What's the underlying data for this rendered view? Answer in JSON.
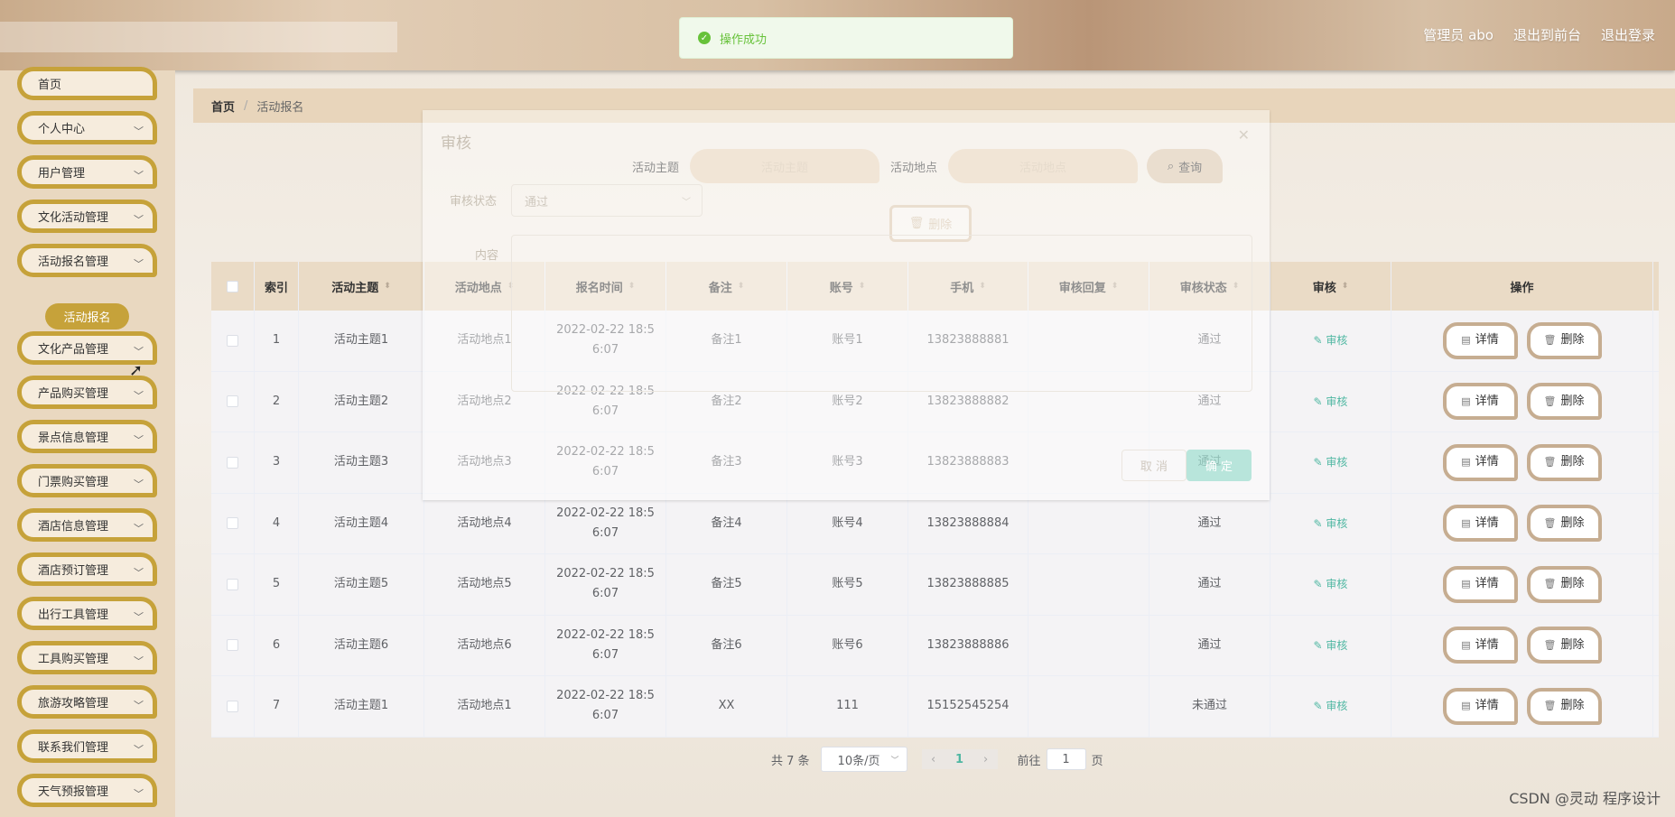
{
  "header": {
    "user_label": "管理员 abo",
    "back_label": "退出到前台",
    "logout_label": "退出登录"
  },
  "toast": {
    "message": "操作成功"
  },
  "sidebar": {
    "items": [
      {
        "label": "首页"
      },
      {
        "label": "个人中心"
      },
      {
        "label": "用户管理"
      },
      {
        "label": "文化活动管理"
      },
      {
        "label": "活动报名管理"
      },
      {
        "label": "文化产品管理"
      },
      {
        "label": "产品购买管理"
      },
      {
        "label": "景点信息管理"
      },
      {
        "label": "门票购买管理"
      },
      {
        "label": "酒店信息管理"
      },
      {
        "label": "酒店预订管理"
      },
      {
        "label": "出行工具管理"
      },
      {
        "label": "工具购买管理"
      },
      {
        "label": "旅游攻略管理"
      },
      {
        "label": "联系我们管理"
      },
      {
        "label": "天气预报管理"
      }
    ],
    "active_sub": "活动报名"
  },
  "breadcrumb": {
    "home": "首页",
    "separator": "/",
    "current": "活动报名"
  },
  "search": {
    "topic_label": "活动主题",
    "topic_placeholder": "活动主题",
    "place_label": "活动地点",
    "place_placeholder": "活动地点",
    "query_label": "查询"
  },
  "delete_label": "删除",
  "dialog": {
    "title": "审核",
    "status_label": "审核状态",
    "status_value": "通过",
    "content_label": "内容",
    "cancel_label": "取 消",
    "confirm_label": "确 定"
  },
  "table": {
    "headers": [
      "索引",
      "活动主题",
      "活动地点",
      "报名时间",
      "备注",
      "账号",
      "手机",
      "审核回复",
      "审核状态",
      "审核",
      "操作"
    ],
    "audit_link": "审核",
    "detail_label": "详情",
    "delete_label": "删除",
    "rows": [
      {
        "idx": "1",
        "topic": "活动主题1",
        "place": "活动地点1",
        "time1": "2022-02-22 18:5",
        "time2": "6:07",
        "note": "备注1",
        "account": "账号1",
        "phone": "13823888881",
        "reply": "",
        "status": "通过"
      },
      {
        "idx": "2",
        "topic": "活动主题2",
        "place": "活动地点2",
        "time1": "2022-02-22 18:5",
        "time2": "6:07",
        "note": "备注2",
        "account": "账号2",
        "phone": "13823888882",
        "reply": "",
        "status": "通过"
      },
      {
        "idx": "3",
        "topic": "活动主题3",
        "place": "活动地点3",
        "time1": "2022-02-22 18:5",
        "time2": "6:07",
        "note": "备注3",
        "account": "账号3",
        "phone": "13823888883",
        "reply": "",
        "status": "通过"
      },
      {
        "idx": "4",
        "topic": "活动主题4",
        "place": "活动地点4",
        "time1": "2022-02-22 18:5",
        "time2": "6:07",
        "note": "备注4",
        "account": "账号4",
        "phone": "13823888884",
        "reply": "",
        "status": "通过"
      },
      {
        "idx": "5",
        "topic": "活动主题5",
        "place": "活动地点5",
        "time1": "2022-02-22 18:5",
        "time2": "6:07",
        "note": "备注5",
        "account": "账号5",
        "phone": "13823888885",
        "reply": "",
        "status": "通过"
      },
      {
        "idx": "6",
        "topic": "活动主题6",
        "place": "活动地点6",
        "time1": "2022-02-22 18:5",
        "time2": "6:07",
        "note": "备注6",
        "account": "账号6",
        "phone": "13823888886",
        "reply": "",
        "status": "通过"
      },
      {
        "idx": "7",
        "topic": "活动主题1",
        "place": "活动地点1",
        "time1": "2022-02-22 18:5",
        "time2": "6:07",
        "note": "XX",
        "account": "111",
        "phone": "15152545254",
        "reply": "",
        "status": "未通过"
      }
    ]
  },
  "pagination": {
    "total": "共 7 条",
    "page_size": "10条/页",
    "current_page": "1",
    "goto_label": "前往",
    "goto_value": "1",
    "page_suffix": "页"
  },
  "watermark": "CSDN @灵动 程序设计"
}
